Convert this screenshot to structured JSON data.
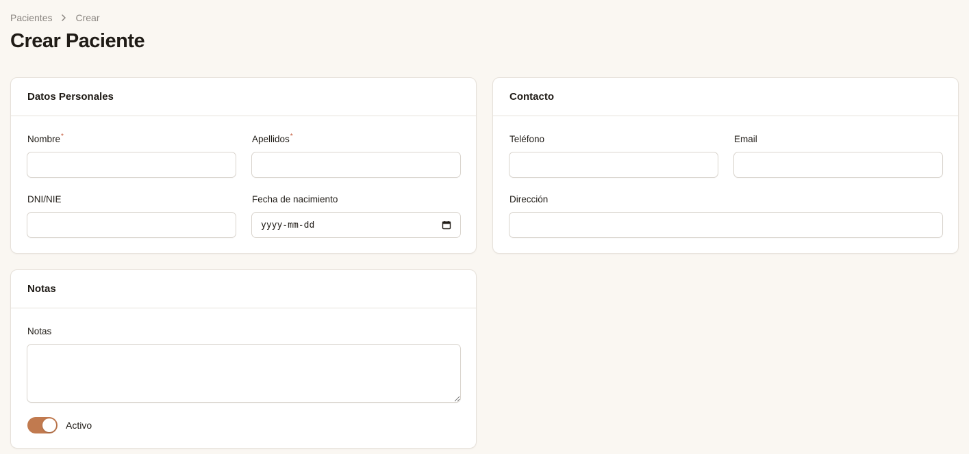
{
  "breadcrumb": {
    "items": [
      "Pacientes",
      "Crear"
    ]
  },
  "page": {
    "title": "Crear Paciente"
  },
  "datos_personales": {
    "title": "Datos Personales",
    "nombre_label": "Nombre",
    "apellidos_label": "Apellidos",
    "required_mark": "*",
    "dni_label": "DNI/NIE",
    "fecha_label": "Fecha de nacimiento",
    "fecha_placeholder": "yyyy-mm-dd",
    "nombre_value": "",
    "apellidos_value": "",
    "dni_value": ""
  },
  "contacto": {
    "title": "Contacto",
    "telefono_label": "Teléfono",
    "email_label": "Email",
    "direccion_label": "Dirección",
    "telefono_value": "",
    "email_value": "",
    "direccion_value": ""
  },
  "notas": {
    "title": "Notas",
    "notas_label": "Notas",
    "notas_value": "",
    "activo_label": "Activo",
    "activo_on": true
  },
  "colors": {
    "accent": "#c17a4f",
    "background": "#faf7f2",
    "required": "#c45a3a"
  },
  "icons": {
    "breadcrumb_separator": "chevron-right-icon",
    "date_picker": "calendar-icon"
  }
}
